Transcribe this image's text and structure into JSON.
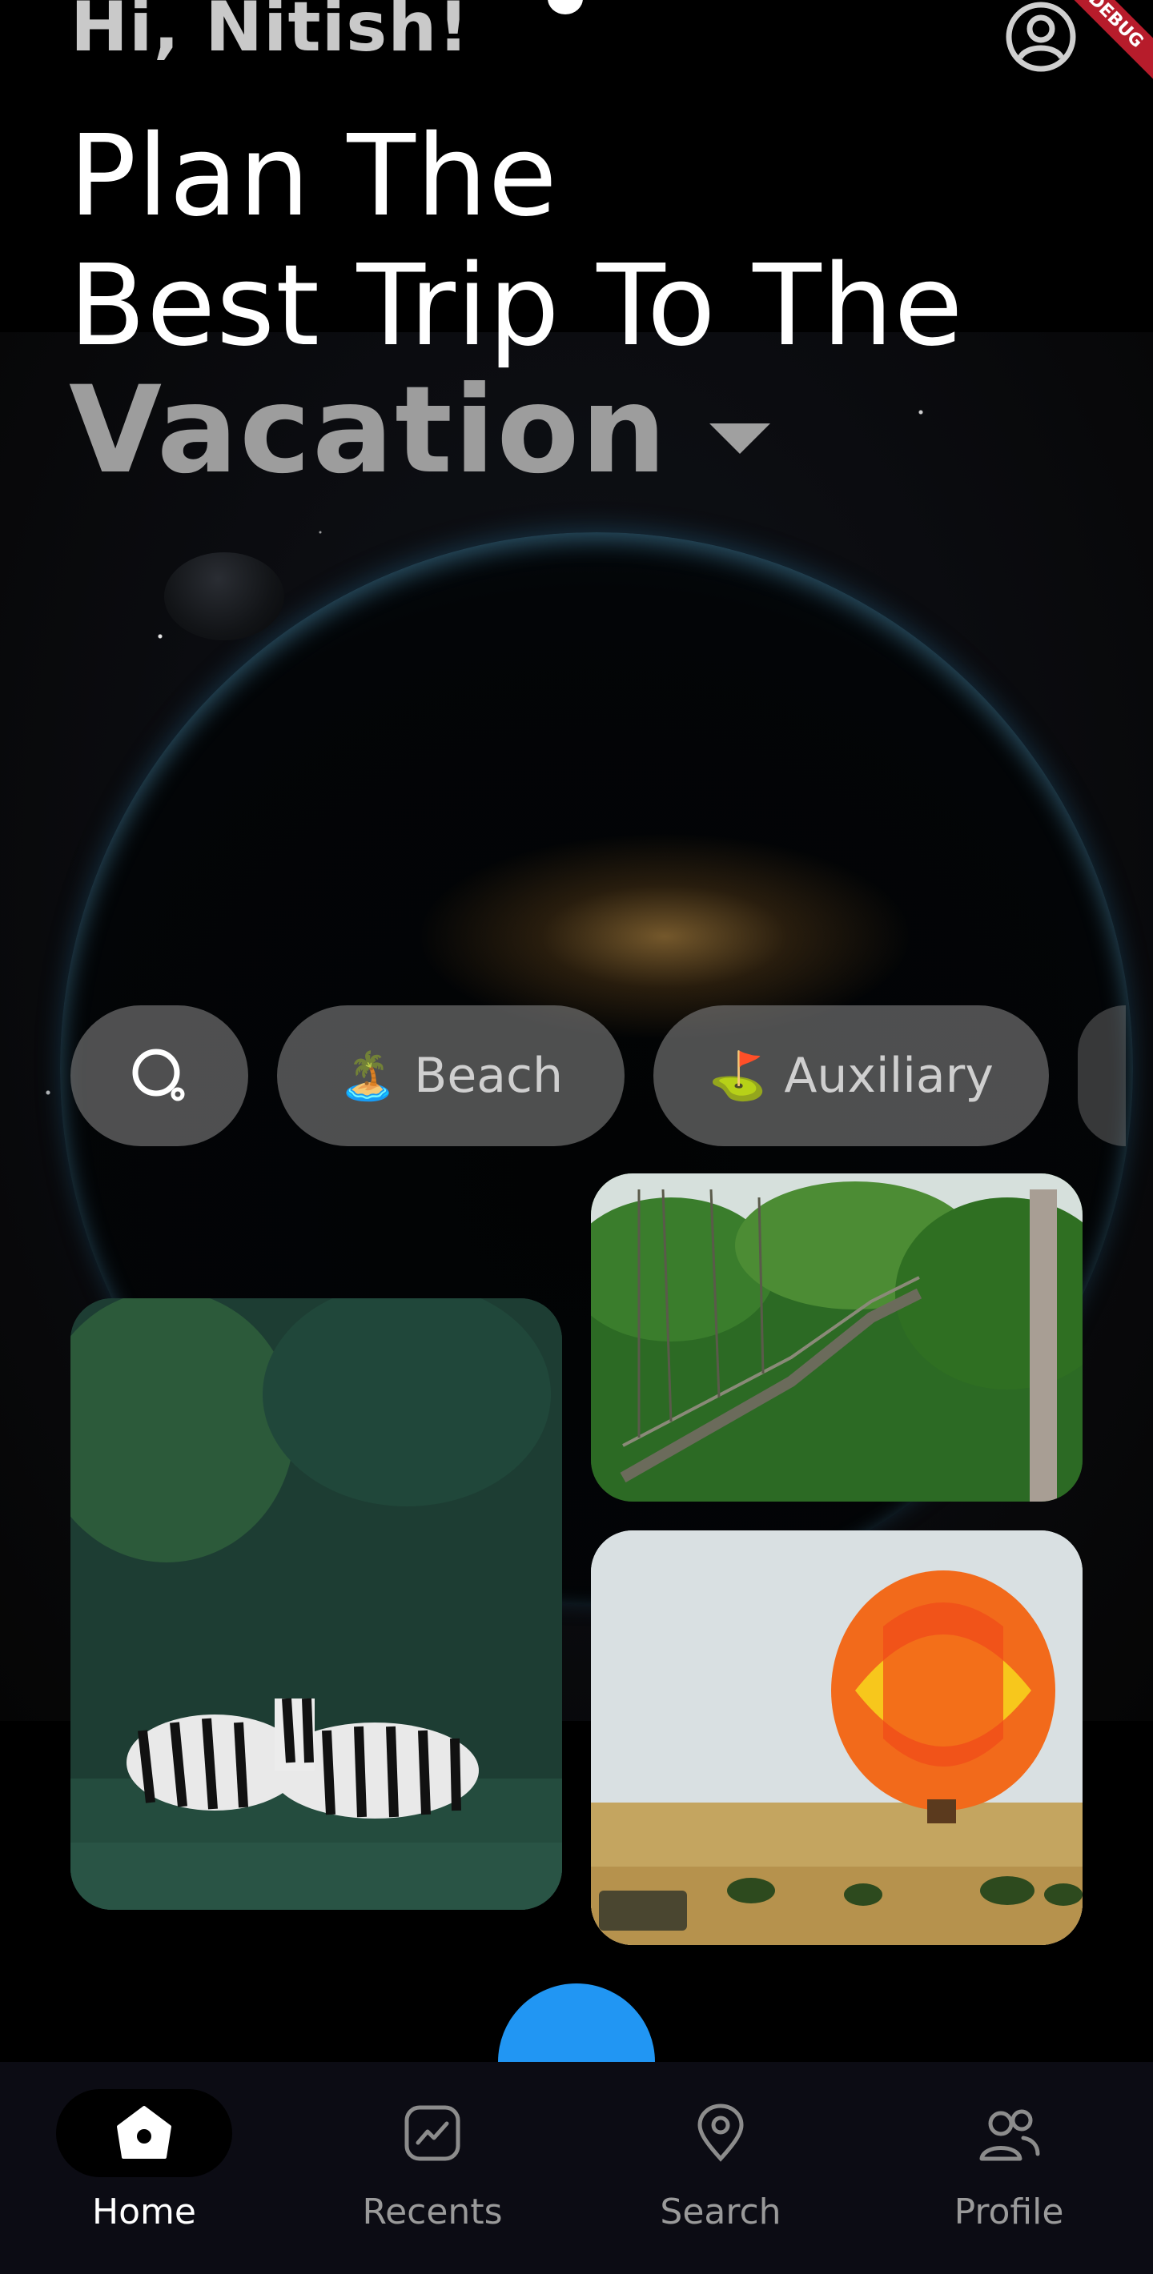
{
  "header": {
    "greeting": "Hi, Nitish!",
    "headline_line1": "Plan The",
    "headline_line2": "Best Trip To The",
    "category_selected": "Vacation",
    "debug_banner": "DEBUG"
  },
  "chips": [
    {
      "label": "",
      "icon": "search-icon"
    },
    {
      "label": "Beach",
      "emoji": "🏝️"
    },
    {
      "label": "Auxiliary",
      "emoji": "⛳"
    }
  ],
  "photos": [
    {
      "icon": "zebras-photo"
    },
    {
      "icon": "canopy-bridge-photo"
    },
    {
      "icon": "hot-air-balloon-photo"
    }
  ],
  "bottom_nav": {
    "items": [
      {
        "label": "Home",
        "icon": "home-icon",
        "active": true
      },
      {
        "label": "Recents",
        "icon": "trending-icon",
        "active": false
      },
      {
        "label": "Search",
        "icon": "location-pin-icon",
        "active": false
      },
      {
        "label": "Profile",
        "icon": "people-icon",
        "active": false
      }
    ]
  },
  "colors": {
    "fab": "#2196f3",
    "nav_background": "#0c0c14",
    "chip_background": "#787878",
    "debug_ribbon": "#b71c2b"
  }
}
